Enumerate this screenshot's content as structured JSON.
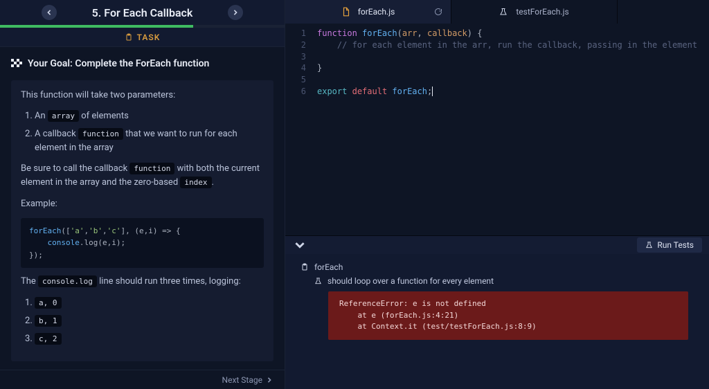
{
  "lesson": {
    "title": "5. For Each Callback",
    "progress_pct": 68
  },
  "task_tab": "TASK",
  "goal": {
    "heading": "Your Goal: Complete the ForEach function"
  },
  "task": {
    "intro": "This function will take two parameters:",
    "list": [
      {
        "prefix": "An ",
        "code": "array",
        "suffix": " of elements"
      },
      {
        "prefix": "A callback ",
        "code": "function",
        "suffix": " that we want to run for each element in the array"
      }
    ],
    "besure_1": "Be sure to call the callback ",
    "besure_code": "function",
    "besure_2": " with both the current element in the array and the zero-based ",
    "besure_code2": "index",
    "besure_3": ".",
    "example_label": "Example:",
    "example_code": "forEach(['a','b','c'], (e,i) => {\n    console.log(e,i);\n});",
    "console_line_1": "The ",
    "console_code": "console.log",
    "console_line_2": " line should run three times, logging:",
    "outputs": [
      "a, 0",
      "b, 1",
      "c, 2"
    ]
  },
  "next_stage": "Next Stage",
  "editor": {
    "tabs": [
      {
        "name": "forEach.js",
        "icon": "js",
        "active": true,
        "dirty": true
      },
      {
        "name": "testForEach.js",
        "icon": "test",
        "active": false,
        "dirty": false
      }
    ],
    "lines": [
      "function forEach(arr, callback) {",
      "    // for each element in the arr, run the callback, passing in the element",
      "",
      "}",
      "",
      "export default forEach;"
    ]
  },
  "tests": {
    "run_label": "Run Tests",
    "group": "forEach",
    "it": "should loop over a function for every element",
    "error": "ReferenceError: e is not defined\n    at e (forEach.js:4:21)\n    at Context.it (test/testForEach.js:8:9)"
  }
}
